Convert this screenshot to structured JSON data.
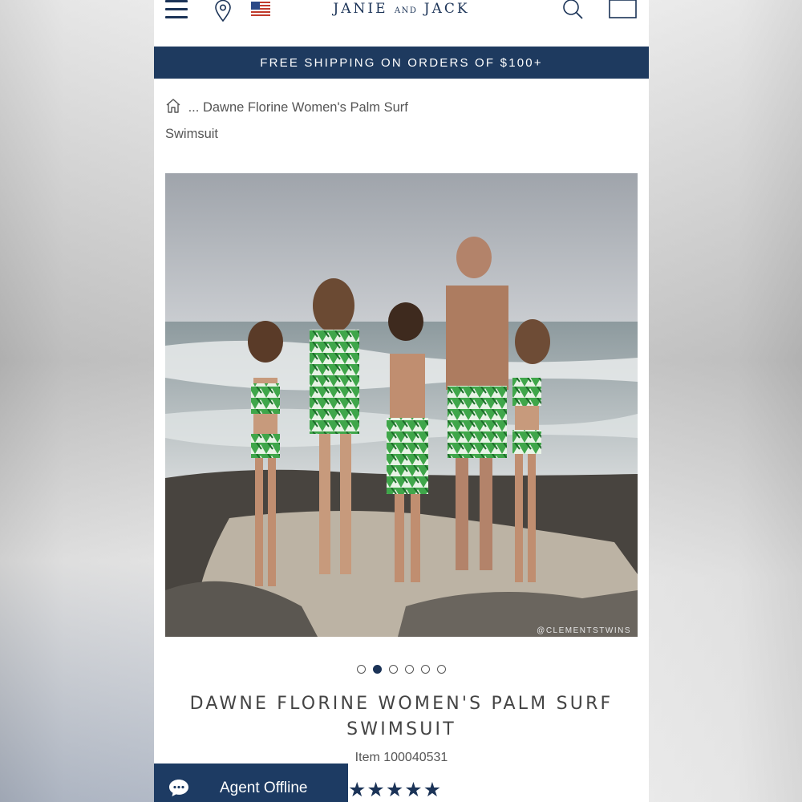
{
  "header": {
    "brand_main_1": "JANIE",
    "brand_and": "AND",
    "brand_main_2": "JACK",
    "icons": [
      "menu-icon",
      "location-pin-icon",
      "us-flag-icon",
      "search-icon",
      "shopping-bag-icon"
    ]
  },
  "promo": {
    "text": "FREE SHIPPING ON ORDERS OF $100+"
  },
  "breadcrumb": {
    "home_icon": "home-icon",
    "ellipsis": "...",
    "current": "Dawne Florine Women's Palm Surf Swimsuit"
  },
  "gallery": {
    "watermark": "@CLEMENTSTWINS",
    "slide_count": 6,
    "active_slide": 2
  },
  "product": {
    "title": "DAWNE FLORINE WOMEN'S PALM SURF SWIMSUIT",
    "item_number": "Item 100040531",
    "rating_stars": 5
  },
  "chat": {
    "label": "Agent Offline",
    "icon": "chat-bubble-icon"
  },
  "colors": {
    "navy": "#1e3a5f",
    "text_gray": "#555555",
    "white": "#ffffff"
  }
}
